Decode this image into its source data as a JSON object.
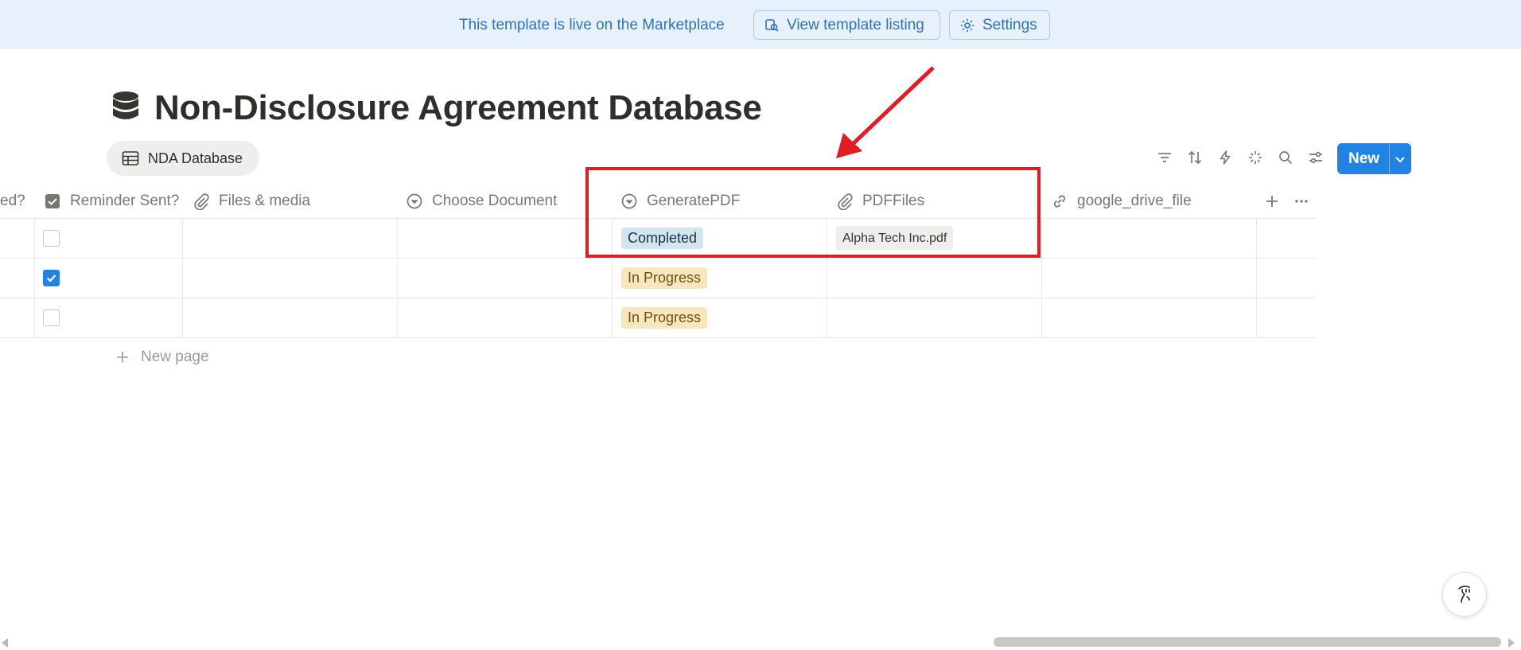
{
  "banner": {
    "message": "This template is live on the Marketplace",
    "view_listing_label": "View template listing",
    "settings_label": "Settings"
  },
  "page": {
    "title": "Non-Disclosure Agreement Database",
    "icon": "database-icon"
  },
  "view_tab": {
    "label": "NDA Database",
    "icon": "table-icon"
  },
  "toolbar": {
    "icons": [
      "filter-icon",
      "sort-icon",
      "automation-icon",
      "ai-sparkle-icon",
      "search-icon",
      "settings-sliders-icon"
    ],
    "new_label": "New",
    "accent": "#2383e2"
  },
  "columns": [
    {
      "label": "ed?",
      "icon": ""
    },
    {
      "label": "Reminder Sent?",
      "icon": "checkbox-icon"
    },
    {
      "label": "Files & media",
      "icon": "paperclip-icon"
    },
    {
      "label": "Choose Document",
      "icon": "select-icon"
    },
    {
      "label": "GeneratePDF",
      "icon": "select-icon"
    },
    {
      "label": "PDFFiles",
      "icon": "paperclip-icon"
    },
    {
      "label": "google_drive_file",
      "icon": "link-icon"
    }
  ],
  "rows": [
    {
      "reminder_sent": false,
      "generate_pdf": "Completed",
      "generate_pdf_color": "#d3e5ef",
      "pdf_file": "Alpha Tech Inc.pdf"
    },
    {
      "reminder_sent": true,
      "generate_pdf": "In Progress",
      "generate_pdf_color": "#f7e7bf",
      "pdf_file": ""
    },
    {
      "reminder_sent": false,
      "generate_pdf": "In Progress",
      "generate_pdf_color": "#f7e7bf",
      "pdf_file": ""
    }
  ],
  "new_page_label": "New page",
  "annotation": {
    "highlight_color": "#e11d24"
  }
}
